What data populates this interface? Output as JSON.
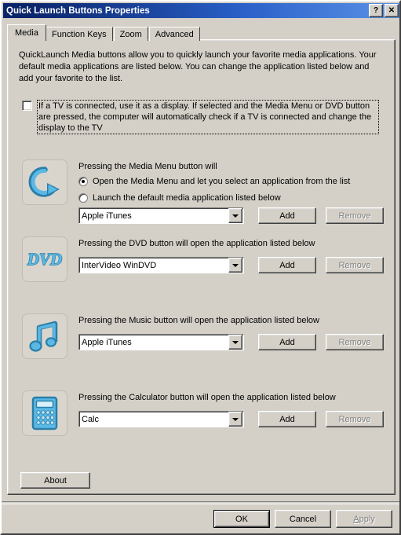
{
  "window": {
    "title": "Quick Launch Buttons Properties",
    "help_button": "?",
    "close_button": "✕"
  },
  "tabs": [
    {
      "label": "Media",
      "active": true
    },
    {
      "label": "Function Keys",
      "active": false
    },
    {
      "label": "Zoom",
      "active": false
    },
    {
      "label": "Advanced",
      "active": false
    }
  ],
  "intro_text": "QuickLaunch Media buttons allow you to quickly launch your favorite media applications. Your default media applications are listed below. You can change the application listed below and add your favorite to the list.",
  "tv_option": {
    "checked": false,
    "label": "If a TV is connected, use it as a display.  If selected and the Media Menu or DVD button are pressed, the computer will automatically check if a TV is connected and change the display to the TV"
  },
  "sections": [
    {
      "icon": "media-menu-icon",
      "label": "Pressing the Media Menu button will",
      "radios": [
        {
          "label": "Open the Media Menu and let you select an application from the list",
          "selected": true
        },
        {
          "label": "Launch the default media application listed below",
          "selected": false
        }
      ],
      "combo_value": "Apple iTunes",
      "add_label": "Add",
      "remove_label": "Remove",
      "remove_disabled": true
    },
    {
      "icon": "dvd-icon",
      "label": "Pressing the DVD button will open the application listed below",
      "radios": [],
      "combo_value": "InterVideo WinDVD",
      "add_label": "Add",
      "remove_label": "Remove",
      "remove_disabled": true
    },
    {
      "icon": "music-note-icon",
      "label": "Pressing the Music button will open the application listed below",
      "radios": [],
      "combo_value": "Apple iTunes",
      "add_label": "Add",
      "remove_label": "Remove",
      "remove_disabled": true
    },
    {
      "icon": "calculator-icon",
      "label": "Pressing the Calculator button will open the application listed below",
      "radios": [],
      "combo_value": "Calc",
      "add_label": "Add",
      "remove_label": "Remove",
      "remove_disabled": true
    }
  ],
  "about_button": "About",
  "footer": {
    "ok": "OK",
    "cancel": "Cancel",
    "apply_prefix": "A",
    "apply_rest": "pply"
  },
  "colors": {
    "dialog_face": "#d4d0c8",
    "title_bar_start": "#0a246a",
    "title_bar_end": "#5b93e8",
    "icon_blue": "#4fb0dd",
    "icon_blue_dark": "#2a7fa8"
  }
}
